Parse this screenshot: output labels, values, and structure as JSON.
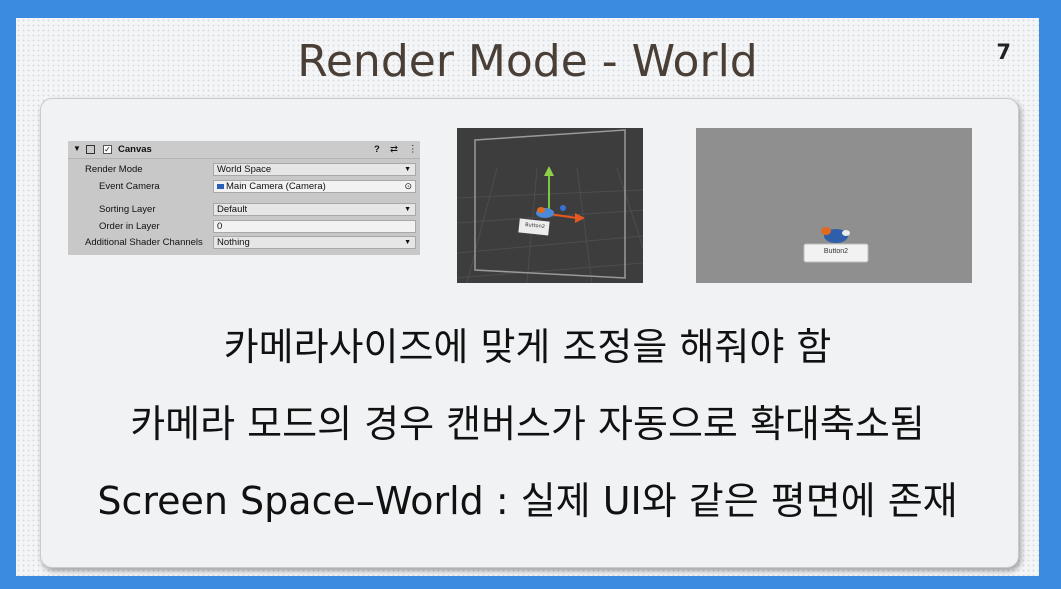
{
  "slide": {
    "title": "Render Mode - World",
    "page_number": "7"
  },
  "inspector": {
    "component_name": "Canvas",
    "checkbox_mark": "✓",
    "rows": [
      {
        "label": "Render Mode",
        "value": "World Space"
      },
      {
        "label": "Event Camera",
        "value": "Main Camera (Camera)"
      },
      {
        "label": "Sorting Layer",
        "value": "Default"
      },
      {
        "label": "Order in Layer",
        "value": "0"
      },
      {
        "label": "Additional Shader Channels",
        "value": "Nothing"
      }
    ]
  },
  "scene_view": {
    "button_label": "Button2"
  },
  "game_view": {
    "button_label": "Button2"
  },
  "text_lines": [
    "카메라사이즈에 맞게 조정을 해줘야 함",
    "카메라 모드의 경우 캔버스가 자동으로 확대축소됨",
    "Screen Space–World : 실제 UI와 같은 평면에 존재"
  ],
  "colors": {
    "frame": "#3b8be0",
    "slide_bg": "#f4f5f7",
    "title_text": "#4a3f37",
    "inspector_bg": "#c8c8c8",
    "scene_bg": "#3d3d3d",
    "game_bg": "#8f8f8f"
  },
  "icons": [
    "foldout-arrow-icon",
    "canvas-component-icon",
    "help-icon",
    "preset-icon",
    "menu-dots-icon",
    "camera-icon",
    "object-picker-icon",
    "dropdown-arrow-icon"
  ]
}
